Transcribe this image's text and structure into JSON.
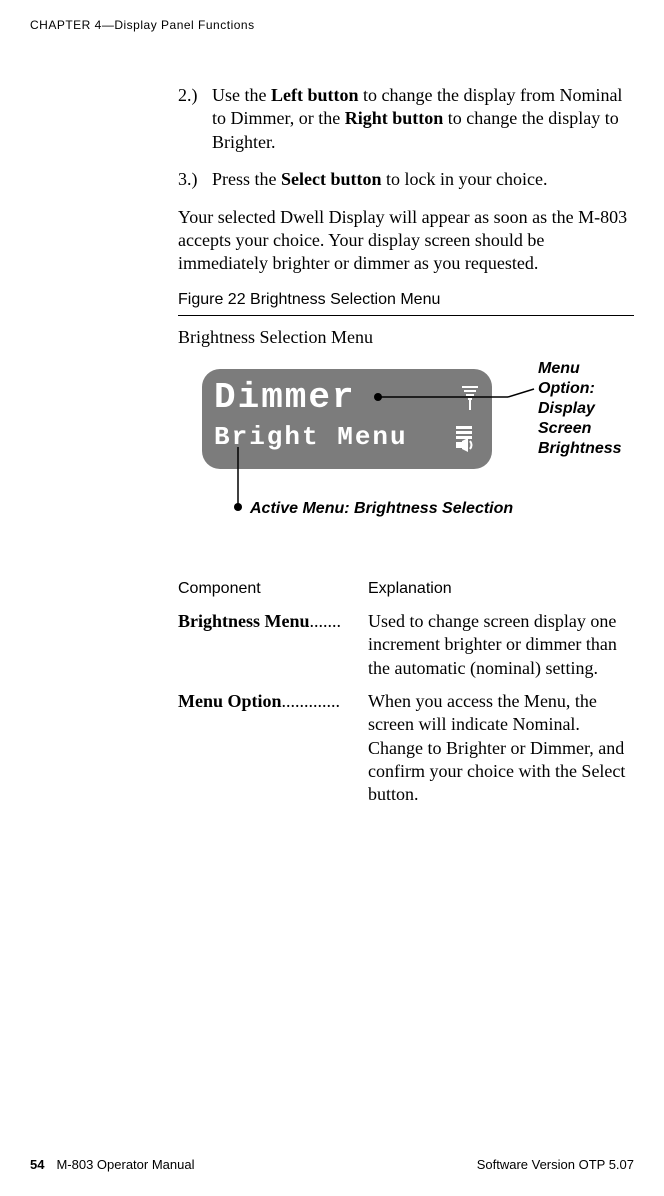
{
  "header": "CHAPTER 4—Display Panel Functions",
  "steps": [
    {
      "num": "2.)",
      "before": "Use the ",
      "bold1": "Left button",
      "mid": " to change the display from Nominal to Dimmer, or the ",
      "bold2": "Right button",
      "after": " to change the display to Brighter."
    },
    {
      "num": "3.)",
      "before": "Press the ",
      "bold1": "Select button",
      "mid": "",
      "bold2": "",
      "after": " to lock in your choice."
    }
  ],
  "para_after_steps": "Your selected Dwell Display will appear as soon as the M-803 accepts your choice. Your display screen should be immediately brighter or dimmer as you requested.",
  "figure_caption": "Figure 22 Brightness Selection Menu",
  "figure_label": "Brightness Selection Menu",
  "lcd": {
    "row1_text": "Dimmer",
    "row2_text": "Bright Menu"
  },
  "annot_right_lines": [
    "Menu",
    "Option:",
    "Display",
    "Screen",
    "Brightness"
  ],
  "annot_bottom": "Active Menu: Brightness Selection",
  "table": {
    "head_col1": "Component",
    "head_col2": "Explanation",
    "rows": [
      {
        "term": "Brightness Menu",
        "dots": ".......",
        "explain": "Used to change screen display one increment brighter or dimmer than the automatic (nominal) setting."
      },
      {
        "term": "Menu Option",
        "dots": ".............",
        "explain": "When you access the Menu, the screen will indicate Nominal. Change to Brighter or Dimmer, and confirm your choice with the Select button."
      }
    ]
  },
  "footer": {
    "pagenum": "54",
    "manual": "M-803 Operator Manual",
    "version": "Software Version OTP 5.07"
  }
}
